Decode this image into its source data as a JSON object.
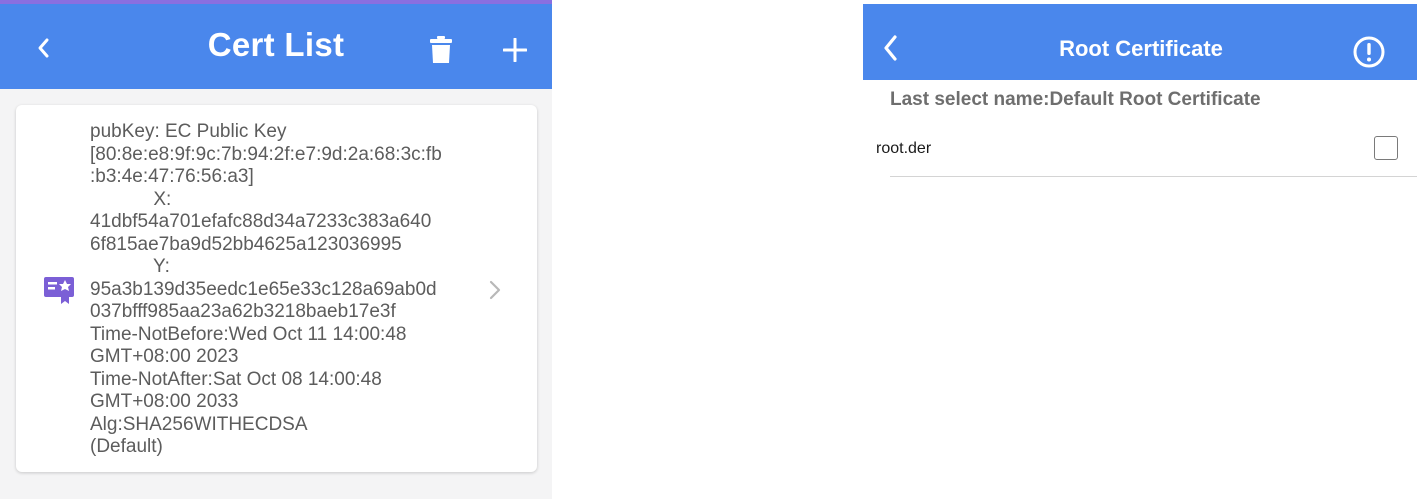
{
  "left": {
    "title": "Cert List",
    "icons": {
      "back": "chevron-left-icon",
      "delete": "trash-icon",
      "add": "plus-icon"
    },
    "card": {
      "lines": [
        "pubKey: EC Public Key",
        "[80:8e:e8:9f:9c:7b:94:2f:e7:9d:2a:68:3c:fb",
        ":b3:4e:47:76:56:a3]",
        "            X:",
        "41dbf54a701efafc88d34a7233c383a640",
        "6f815ae7ba9d52bb4625a123036995",
        "            Y:",
        "95a3b139d35eedc1e65e33c128a69ab0d",
        "037bfff985aa23a62b3218baeb17e3f",
        "Time-NotBefore:Wed Oct 11 14:00:48",
        "GMT+08:00 2023",
        "Time-NotAfter:Sat Oct 08 14:00:48",
        "GMT+08:00 2033",
        "Alg:SHA256WITHECDSA",
        "(Default)"
      ],
      "icon": "certificate-icon",
      "chevron": "chevron-right-icon"
    }
  },
  "right": {
    "title": "Root Certificate",
    "icons": {
      "back": "chevron-left-icon",
      "info": "exclamation-circle-icon"
    },
    "last_select": "Last select name:Default Root Certificate",
    "items": [
      {
        "label": "root.der",
        "checked": false
      }
    ]
  },
  "colors": {
    "header": "#4a87ec",
    "accent_strip": "#8a6fe0",
    "cert_icon": "#7b5fd6",
    "left_bg": "#f4f4f5",
    "card_text": "#5c5c5c"
  }
}
